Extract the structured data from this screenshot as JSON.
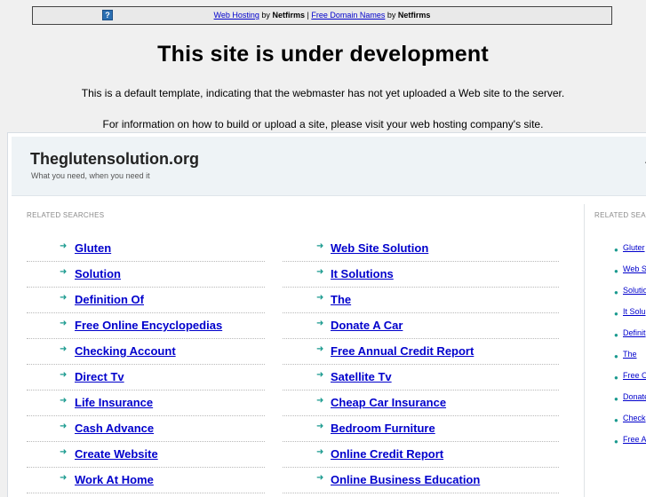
{
  "topbar": {
    "help_icon": "question-icon",
    "link1": "Web Hosting",
    "by1": "by",
    "brand1": "Netfirms",
    "sep": "|",
    "link2": "Free Domain Names",
    "by2": "by",
    "brand2": "Netfirms"
  },
  "headline": "This site is under development",
  "para1": "This is a default template, indicating that the webmaster has not yet uploaded a Web site to the server.",
  "para2": "For information on how to build or upload a site, please visit your web hosting company's site.",
  "site": {
    "title": "Theglutensolution.org",
    "tagline": "What you need, when you need it",
    "right_glyph": "A"
  },
  "related": {
    "label": "RELATED SEARCHES",
    "left": [
      "Gluten",
      "Solution",
      "Definition Of",
      "Free Online Encyclopedias",
      "Checking Account",
      "Direct Tv",
      "Life Insurance",
      "Cash Advance",
      "Create Website",
      "Work At Home"
    ],
    "mid": [
      "Web Site Solution",
      "It Solutions",
      "The",
      "Donate A Car",
      "Free Annual Credit Report",
      "Satellite Tv",
      "Cheap Car Insurance",
      "Bedroom Furniture",
      "Online Credit Report",
      "Online Business Education"
    ],
    "right_label": "RELATED SEA",
    "right": [
      "Gluter",
      "Web S",
      "Solutio",
      "It Solu",
      "Definit",
      "The",
      "Free O",
      "Donate",
      "Check",
      "Free A"
    ]
  },
  "colors": {
    "link": "#0000cc",
    "arrow": "#1a9a8f",
    "header_bg": "#eef3f6"
  }
}
